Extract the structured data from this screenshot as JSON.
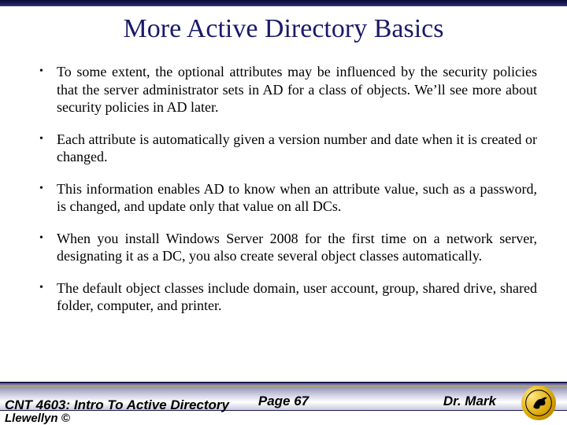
{
  "title": "More Active Directory Basics",
  "bullets": [
    "To some extent, the optional attributes may be influenced by the security policies that the server administrator sets in AD for a class of objects.  We’ll see more about security policies in AD later.",
    "Each attribute is automatically given a version number and date when it is created or changed.",
    "This information enables AD to know when an attribute value, such as a password, is changed, and update only that value on all DCs.",
    "When you install Windows Server 2008 for the first time on a network server, designating it as a DC, you also create several object classes automatically.",
    "The default object classes include domain, user account, group, shared drive, shared folder, computer, and printer."
  ],
  "footer": {
    "course": "CNT 4603: Intro To Active Directory",
    "copyright": "Llewellyn ©",
    "page": "Page 67",
    "author": "Dr. Mark"
  }
}
